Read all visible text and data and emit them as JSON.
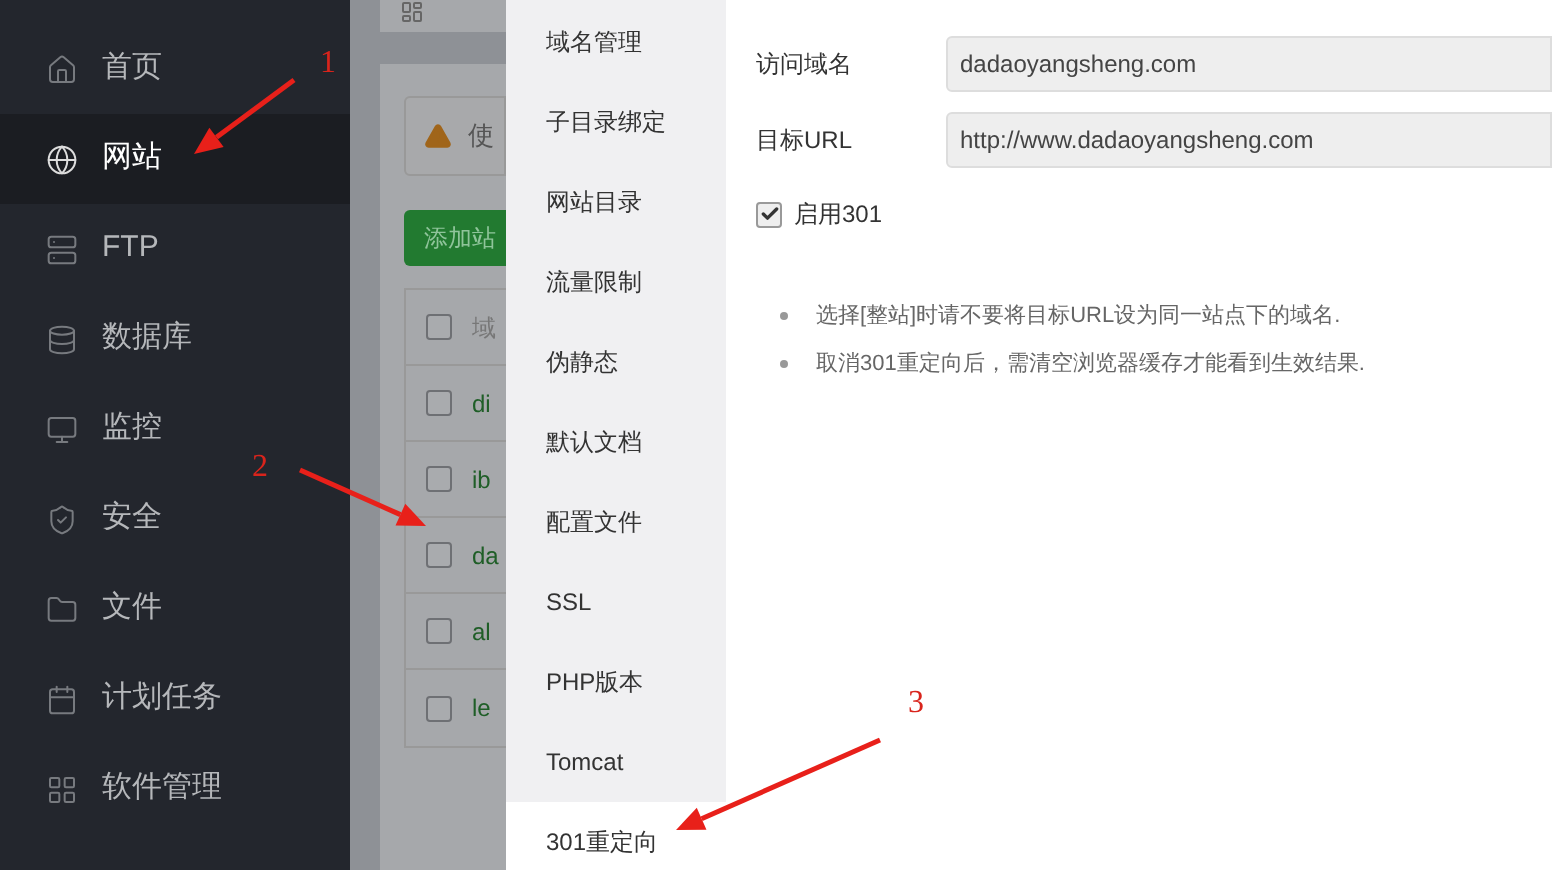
{
  "sidebar": {
    "items": [
      {
        "label": "首页",
        "selected": false
      },
      {
        "label": "网站",
        "selected": true
      },
      {
        "label": "FTP",
        "selected": false
      },
      {
        "label": "数据库",
        "selected": false
      },
      {
        "label": "监控",
        "selected": false
      },
      {
        "label": "安全",
        "selected": false
      },
      {
        "label": "文件",
        "selected": false
      },
      {
        "label": "计划任务",
        "selected": false
      },
      {
        "label": "软件管理",
        "selected": false
      }
    ]
  },
  "background_page": {
    "warning": "使",
    "add_button": "添加站",
    "table": {
      "header": "域",
      "header_checked": false,
      "rows": [
        {
          "domain": "di",
          "checked": false
        },
        {
          "domain": "ib",
          "checked": false
        },
        {
          "domain": "da",
          "checked": false
        },
        {
          "domain": "al",
          "checked": false
        },
        {
          "domain": "le",
          "checked": false
        }
      ]
    }
  },
  "dialog": {
    "menu": [
      {
        "label": "域名管理",
        "selected": false
      },
      {
        "label": "子目录绑定",
        "selected": false
      },
      {
        "label": "网站目录",
        "selected": false
      },
      {
        "label": "流量限制",
        "selected": false
      },
      {
        "label": "伪静态",
        "selected": false
      },
      {
        "label": "默认文档",
        "selected": false
      },
      {
        "label": "配置文件",
        "selected": false
      },
      {
        "label": "SSL",
        "selected": false
      },
      {
        "label": "PHP版本",
        "selected": false
      },
      {
        "label": "Tomcat",
        "selected": false
      },
      {
        "label": "301重定向",
        "selected": true
      }
    ],
    "fields": [
      {
        "label": "访问域名",
        "value": "dadaoyangsheng.com"
      },
      {
        "label": "目标URL",
        "value": "http://www.dadaoyangsheng.com"
      }
    ],
    "enable": {
      "label": "启用301",
      "checked": true
    },
    "notes": [
      "选择[整站]时请不要将目标URL设为同一站点下的域名.",
      "取消301重定向后，需清空浏览器缓存才能看到生效结果."
    ]
  },
  "annotations": [
    {
      "label": "1"
    },
    {
      "label": "2"
    },
    {
      "label": "3"
    }
  ]
}
